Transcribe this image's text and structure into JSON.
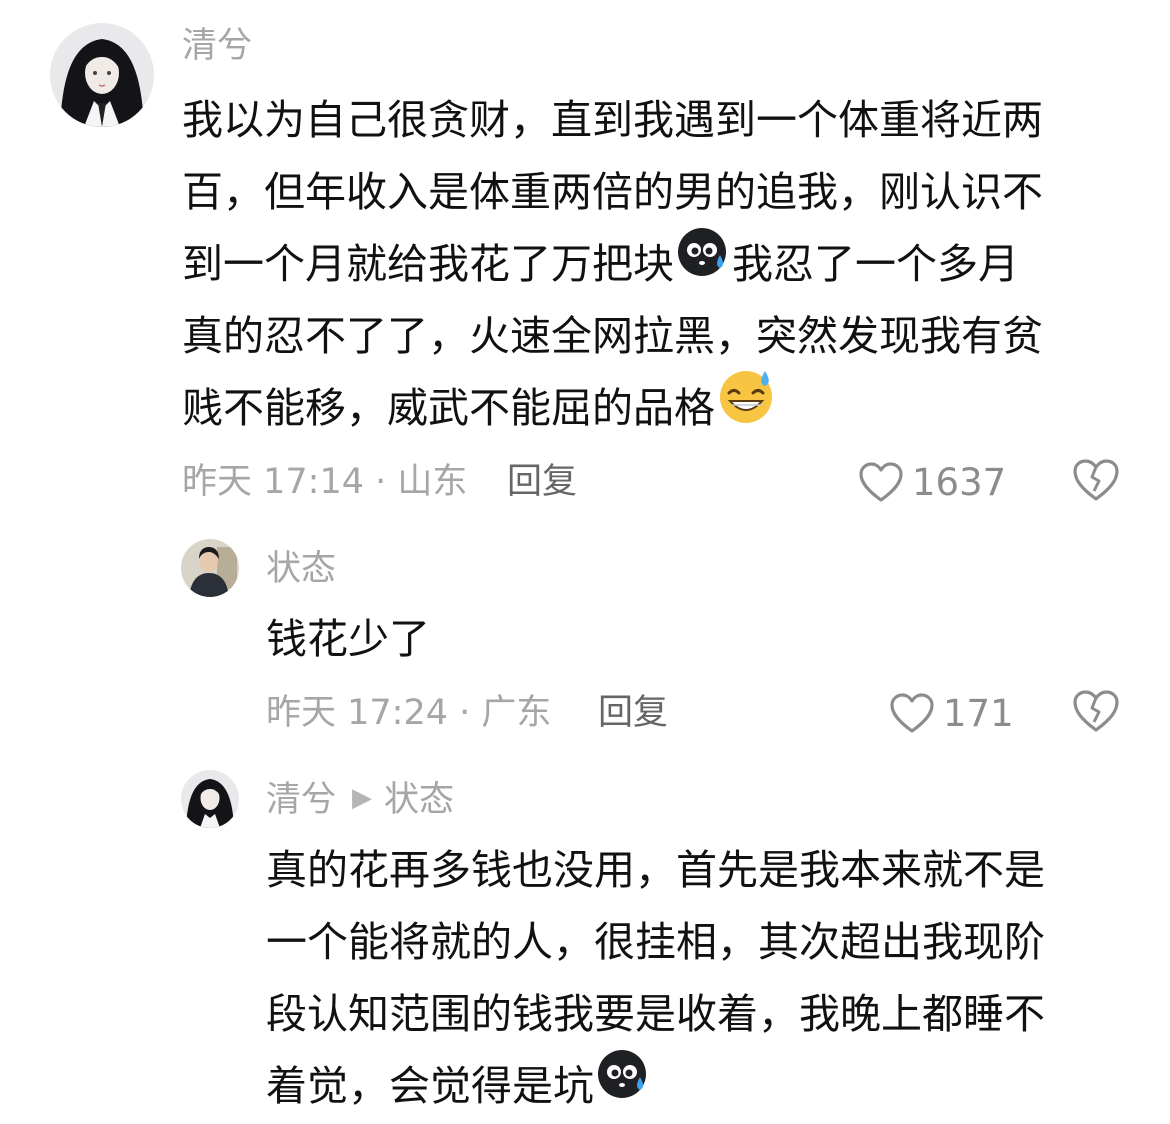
{
  "comments": [
    {
      "username": "清兮",
      "lines": [
        "我以为自己很贪财，直到我遇到一个体重将近两",
        "百，但年收入是体重两倍的男的追我，刚认识不",
        "到一个月就给我花了万把块",
        "我忍了一个多月",
        "真的忍不了了，火速全网拉黑，突然发现我有贫",
        "贱不能移，威武不能屈的品格"
      ],
      "emojis": [
        "sweat-face-dark-icon",
        "grin-sweat-icon"
      ],
      "time_location": "昨天 17:14 · 山东",
      "reply_label": "回复",
      "likes": "1637"
    },
    {
      "username": "状态",
      "lines": [
        "钱花少了"
      ],
      "time_location": "昨天 17:24 · 广东",
      "reply_label": "回复",
      "likes": "171"
    },
    {
      "username": "清兮",
      "reply_to": "状态",
      "lines": [
        "真的花再多钱也没用，首先是我本来就不是",
        "一个能将就的人，很挂相，其次超出我现阶",
        "段认知范围的钱我要是收着，我晚上都睡不",
        "着觉，会觉得是坑"
      ],
      "emojis": [
        "sweat-face-dark-icon"
      ]
    }
  ],
  "colors": {
    "text": "#111111",
    "meta": "#a6a6a6",
    "reply": "#666666",
    "icon": "#8c8c8c"
  }
}
